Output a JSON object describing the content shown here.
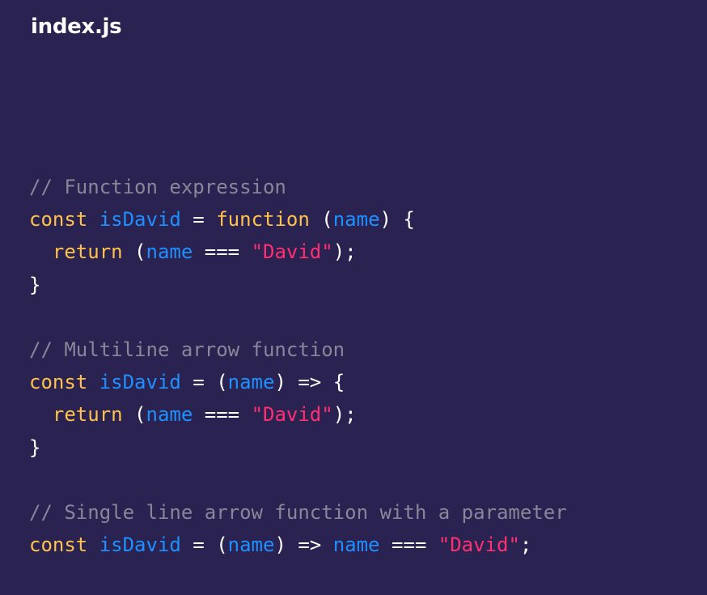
{
  "file": {
    "name": "index.js"
  },
  "colors": {
    "background": "#2a2352",
    "comment": "#8a8699",
    "keyword": "#ffc24a",
    "name": "#1e90ff",
    "string": "#ff2f71",
    "text": "#ffffff"
  },
  "code": {
    "lines": [
      [
        {
          "type": "comment",
          "text": "// Function expression"
        }
      ],
      [
        {
          "type": "keyword",
          "text": "const"
        },
        {
          "type": "punct",
          "text": " "
        },
        {
          "type": "name",
          "text": "isDavid"
        },
        {
          "type": "punct",
          "text": " = "
        },
        {
          "type": "keyword",
          "text": "function"
        },
        {
          "type": "punct",
          "text": " ("
        },
        {
          "type": "name",
          "text": "name"
        },
        {
          "type": "punct",
          "text": ") {"
        }
      ],
      [
        {
          "type": "punct",
          "text": "  "
        },
        {
          "type": "keyword",
          "text": "return"
        },
        {
          "type": "punct",
          "text": " ("
        },
        {
          "type": "name",
          "text": "name"
        },
        {
          "type": "punct",
          "text": " === "
        },
        {
          "type": "string",
          "text": "\"David\""
        },
        {
          "type": "punct",
          "text": ");"
        }
      ],
      [
        {
          "type": "punct",
          "text": "}"
        }
      ],
      [],
      [
        {
          "type": "comment",
          "text": "// Multiline arrow function"
        }
      ],
      [
        {
          "type": "keyword",
          "text": "const"
        },
        {
          "type": "punct",
          "text": " "
        },
        {
          "type": "name",
          "text": "isDavid"
        },
        {
          "type": "punct",
          "text": " = ("
        },
        {
          "type": "name",
          "text": "name"
        },
        {
          "type": "punct",
          "text": ") => {"
        }
      ],
      [
        {
          "type": "punct",
          "text": "  "
        },
        {
          "type": "keyword",
          "text": "return"
        },
        {
          "type": "punct",
          "text": " ("
        },
        {
          "type": "name",
          "text": "name"
        },
        {
          "type": "punct",
          "text": " === "
        },
        {
          "type": "string",
          "text": "\"David\""
        },
        {
          "type": "punct",
          "text": ");"
        }
      ],
      [
        {
          "type": "punct",
          "text": "}"
        }
      ],
      [],
      [
        {
          "type": "comment",
          "text": "// Single line arrow function with a parameter"
        }
      ],
      [
        {
          "type": "keyword",
          "text": "const"
        },
        {
          "type": "punct",
          "text": " "
        },
        {
          "type": "name",
          "text": "isDavid"
        },
        {
          "type": "punct",
          "text": " = ("
        },
        {
          "type": "name",
          "text": "name"
        },
        {
          "type": "punct",
          "text": ") => "
        },
        {
          "type": "name",
          "text": "name"
        },
        {
          "type": "punct",
          "text": " === "
        },
        {
          "type": "string",
          "text": "\"David\""
        },
        {
          "type": "punct",
          "text": ";"
        }
      ]
    ]
  }
}
